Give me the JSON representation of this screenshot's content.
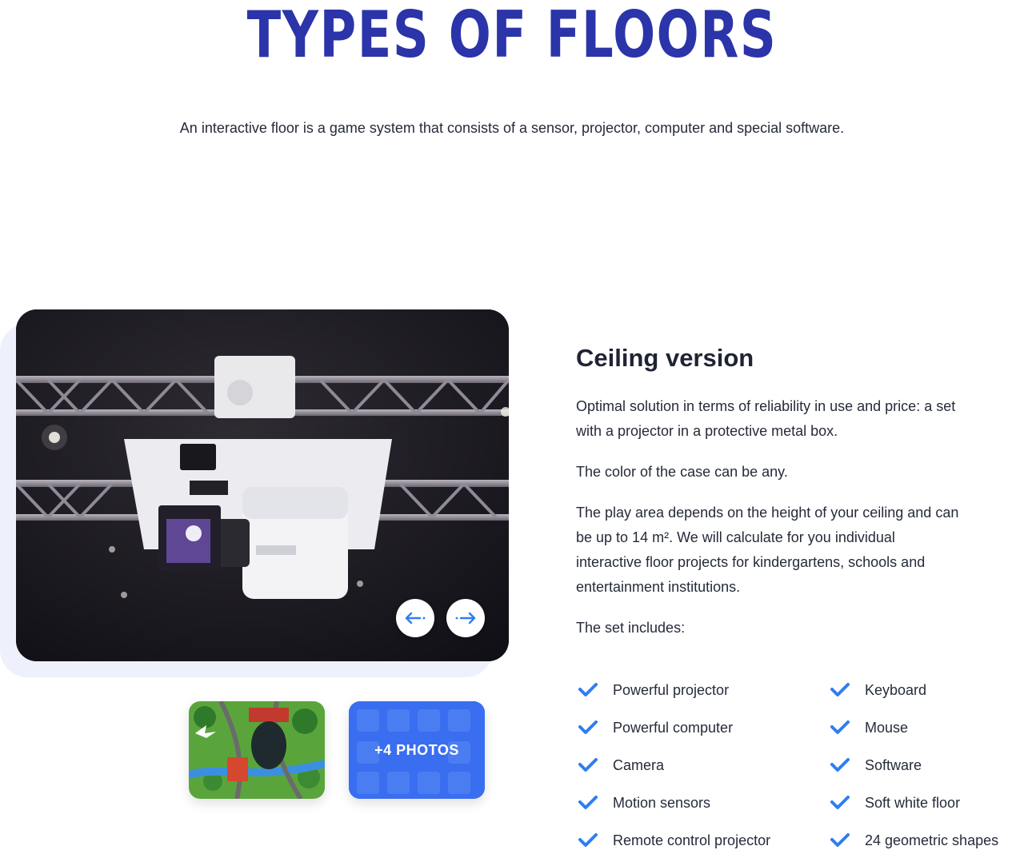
{
  "page": {
    "title": "TYPES OF FLOORS",
    "intro": "An interactive floor is a game system that consists of a sensor, projector, computer and special software."
  },
  "gallery": {
    "main_image": "ceiling-mounted-projector-photo",
    "prev_icon": "arrow-left-icon",
    "next_icon": "arrow-right-icon",
    "thumbnails": [
      {
        "image": "interactive-floor-railway-game-photo"
      },
      {
        "image": "interactive-floor-board-game-photo",
        "label": "+4 PHOTOS"
      }
    ]
  },
  "product": {
    "title": "Ceiling version",
    "paragraphs": [
      "Optimal solution in terms of reliability in use and price: a set with a projector in a protective metal box.",
      "The color of the case can be any.",
      "The play area depends on the height of your ceiling and can be up to 14 m². We will calculate for you individual interactive floor projects for kindergartens, schools and entertainment institutions.",
      "The set includes:"
    ],
    "includes": [
      "Powerful projector",
      "Powerful computer",
      "Camera",
      "Motion sensors",
      "Remote control projector",
      "Keyboard",
      "Mouse",
      "Software",
      "Soft white floor",
      "24 geometric shapes"
    ],
    "check_icon": "checkmark-icon"
  },
  "colors": {
    "title_blue": "#2b34a9",
    "accent_blue": "#3a6ef0",
    "check_blue": "#2f7ef0",
    "text_dark": "#1f2433"
  }
}
